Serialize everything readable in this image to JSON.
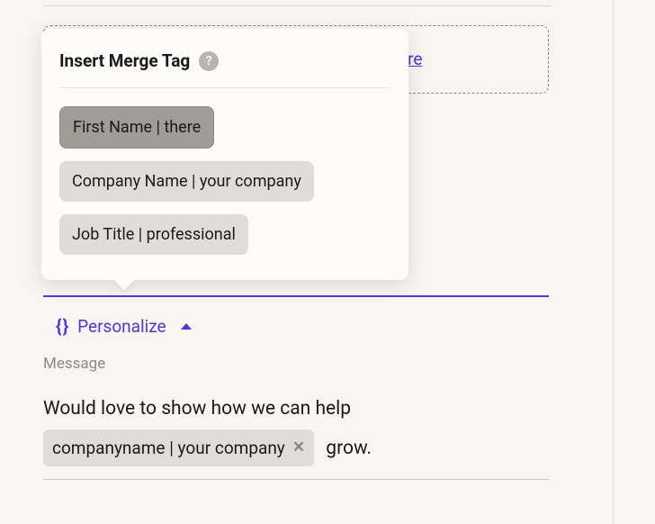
{
  "popup": {
    "title": "Insert Merge Tag",
    "help": "?",
    "items": [
      {
        "label": "First Name | there",
        "selected": true
      },
      {
        "label": "Company Name | your company",
        "selected": false
      },
      {
        "label": "Job Title | professional",
        "selected": false
      }
    ]
  },
  "link_fragment": "ere",
  "personalize": {
    "label": "Personalize",
    "icon": "{ }"
  },
  "message": {
    "label": "Message",
    "prefix": "Would love to show how we can help",
    "tag": "companyname | your company",
    "suffix": "grow."
  },
  "colors": {
    "accent": "#5534db",
    "bg": "#f8f6f3",
    "chip": "#e0ddd8",
    "chip_selected": "#a09c96"
  }
}
